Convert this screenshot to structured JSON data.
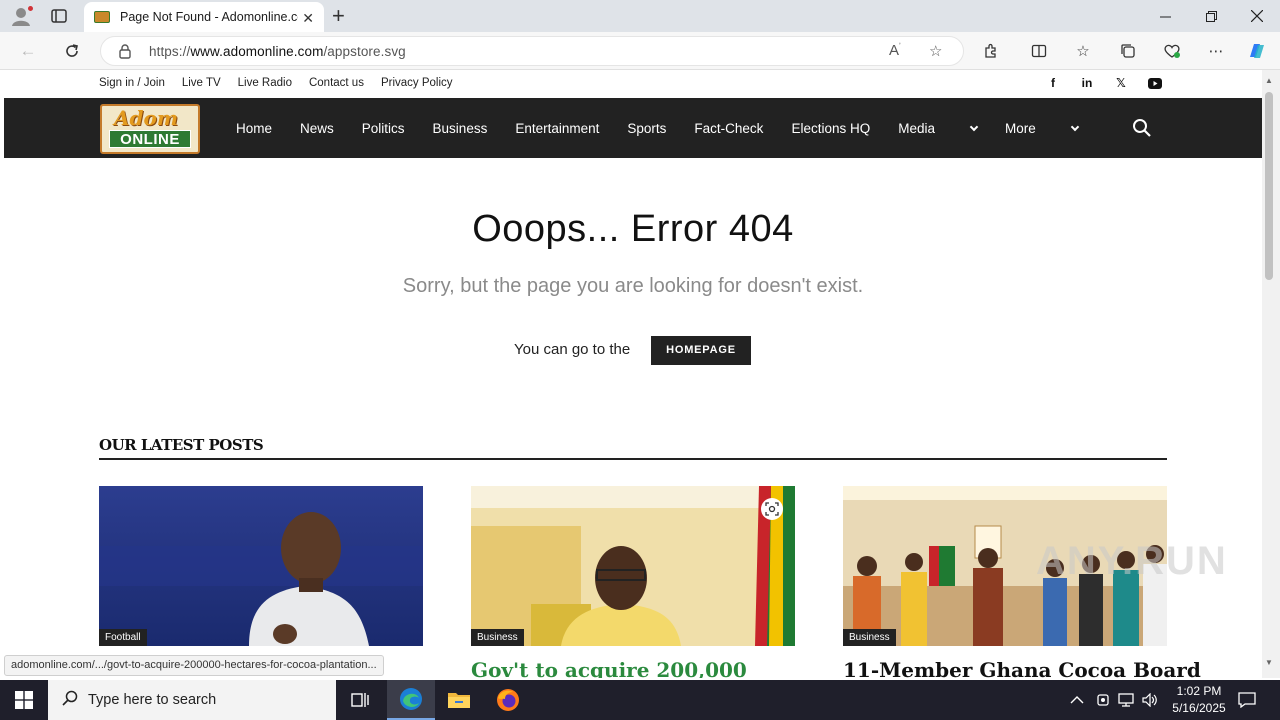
{
  "browser": {
    "tab_title": "Page Not Found - Adomonline.com",
    "url_prefix": "https://",
    "url_domain": "www.adomonline.com",
    "url_path": "/appstore.svg",
    "status_url": "adomonline.com/.../govt-to-acquire-200000-hectares-for-cocoa-plantation..."
  },
  "topbar": {
    "links": [
      "Sign in / Join",
      "Live TV",
      "Live Radio",
      "Contact us",
      "Privacy Policy"
    ],
    "social": [
      "facebook-icon",
      "linkedin-icon",
      "x-icon",
      "youtube-icon"
    ]
  },
  "logo": {
    "top": "Adom",
    "bottom": "ONLINE"
  },
  "nav": {
    "items": [
      "Home",
      "News",
      "Politics",
      "Business",
      "Entertainment",
      "Sports",
      "Fact-Check",
      "Elections HQ",
      "Media",
      "More"
    ]
  },
  "error": {
    "title": "Ooops... Error 404",
    "subtitle": "Sorry, but the page you are looking for doesn't exist.",
    "goto_text": "You can go to the",
    "home_button": "HOMEPAGE"
  },
  "latest": {
    "heading": "OUR LATEST POSTS",
    "posts": [
      {
        "category": "Football",
        "title": ""
      },
      {
        "category": "Business",
        "title": "Gov't to acquire 200,000"
      },
      {
        "category": "Business",
        "title": "11-Member Ghana Cocoa Board"
      }
    ]
  },
  "watermark": "ANY.RUN",
  "taskbar": {
    "search_placeholder": "Type here to search",
    "time": "1:02 PM",
    "date": "5/16/2025"
  },
  "colors": {
    "nav_bg": "#222222",
    "title_green": "#2b8a3e",
    "taskbar": "#1f1f2b"
  }
}
